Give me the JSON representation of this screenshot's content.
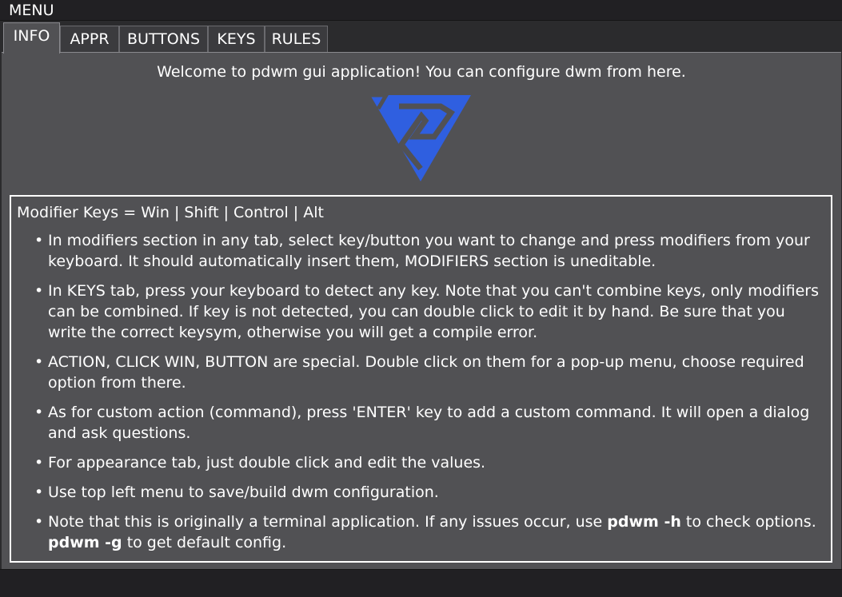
{
  "menubar": {
    "label": "MENU"
  },
  "tabs": [
    {
      "label": "INFO",
      "active": true
    },
    {
      "label": "APPR",
      "active": false
    },
    {
      "label": "BUTTONS",
      "active": false
    },
    {
      "label": "KEYS",
      "active": false
    },
    {
      "label": "RULES",
      "active": false
    }
  ],
  "info": {
    "welcome": "Welcome to pdwm gui application! You can configure dwm from here.",
    "logo_icon": "pdwm-logo-icon",
    "logo_color": "#2f5fe0",
    "modifier_line": "Modifier Keys = Win | Shift | Control | Alt",
    "bullets": [
      "In modifiers section in any tab, select key/button you want to change and press modifiers from your keyboard. It should automatically insert them, MODIFIERS section is uneditable.",
      "In KEYS tab, press your keyboard to detect any key. Note that you can't combine keys, only modifiers can be combined. If key is not detected, you can double click to edit it by hand. Be sure that you write the correct keysym, otherwise you will get a compile error.",
      "ACTION, CLICK WIN, BUTTON are special. Double click on them for a pop-up menu, choose required option from there.",
      "As for custom action (command), press 'ENTER' key to add a custom command. It will open a dialog and ask questions.",
      "For appearance tab, just double click and edit the values.",
      "Use top left menu to save/build dwm configuration."
    ],
    "last_bullet": {
      "part1": "Note that this is originally a terminal application. If any issues occur, use ",
      "cmd_help": "pdwm -h",
      "part2": " to check options. ",
      "cmd_default": "pdwm -g",
      "part3": " to get default config."
    }
  }
}
